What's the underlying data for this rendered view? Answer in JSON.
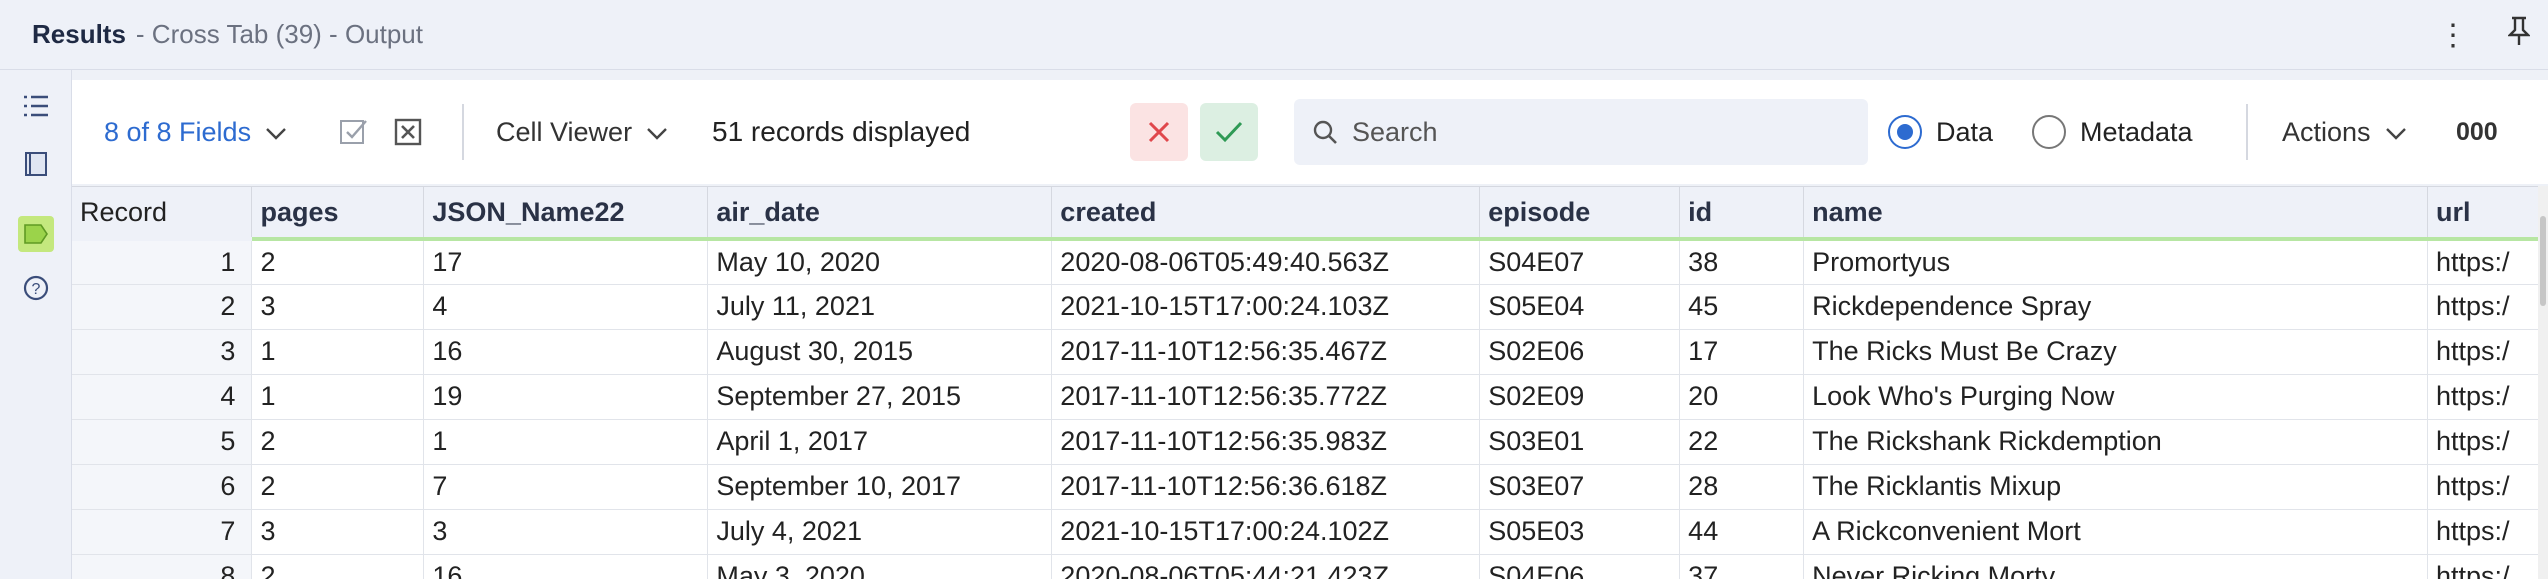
{
  "window": {
    "title_bold": "Results",
    "title_rest": "- Cross Tab (39) - Output"
  },
  "toolbar": {
    "fields_label": "8 of 8 Fields",
    "cell_viewer_label": "Cell Viewer",
    "records_text": "51 records displayed",
    "search_placeholder": "Search",
    "data_label": "Data",
    "metadata_label": "Metadata",
    "actions_label": "Actions",
    "overflow_label": "000",
    "selected_view": "Data"
  },
  "table": {
    "headers": [
      "Record",
      "pages",
      "JSON_Name22",
      "air_date",
      "created",
      "episode",
      "id",
      "name",
      "url"
    ],
    "rows": [
      [
        "1",
        "2",
        "17",
        "May 10, 2020",
        "2020-08-06T05:49:40.563Z",
        "S04E07",
        "38",
        "Promortyus",
        "https:/"
      ],
      [
        "2",
        "3",
        "4",
        "July 11, 2021",
        "2021-10-15T17:00:24.103Z",
        "S05E04",
        "45",
        "Rickdependence Spray",
        "https:/"
      ],
      [
        "3",
        "1",
        "16",
        "August 30, 2015",
        "2017-11-10T12:56:35.467Z",
        "S02E06",
        "17",
        "The Ricks Must Be Crazy",
        "https:/"
      ],
      [
        "4",
        "1",
        "19",
        "September 27, 2015",
        "2017-11-10T12:56:35.772Z",
        "S02E09",
        "20",
        "Look Who's Purging Now",
        "https:/"
      ],
      [
        "5",
        "2",
        "1",
        "April 1, 2017",
        "2017-11-10T12:56:35.983Z",
        "S03E01",
        "22",
        "The Rickshank Rickdemption",
        "https:/"
      ],
      [
        "6",
        "2",
        "7",
        "September 10, 2017",
        "2017-11-10T12:56:36.618Z",
        "S03E07",
        "28",
        "The Ricklantis Mixup",
        "https:/"
      ],
      [
        "7",
        "3",
        "3",
        "July 4, 2021",
        "2021-10-15T17:00:24.102Z",
        "S05E03",
        "44",
        "A Rickconvenient Mort",
        "https:/"
      ],
      [
        "8",
        "2",
        "16",
        "May 3, 2020",
        "2020-08-06T05:44:21.423Z",
        "S04E06",
        "37",
        "Never Ricking Morty",
        "https:/"
      ]
    ]
  },
  "colors": {
    "accent": "#2d6bd0",
    "header_underline": "#b7e6a3",
    "cancel_bg": "#fbe3e3",
    "confirm_bg": "#dcefe2"
  },
  "icons": {
    "left_rail": [
      "list-icon",
      "book-icon",
      "tag-icon",
      "help-icon"
    ],
    "title_right": [
      "more-vertical-icon",
      "pin-icon"
    ]
  }
}
